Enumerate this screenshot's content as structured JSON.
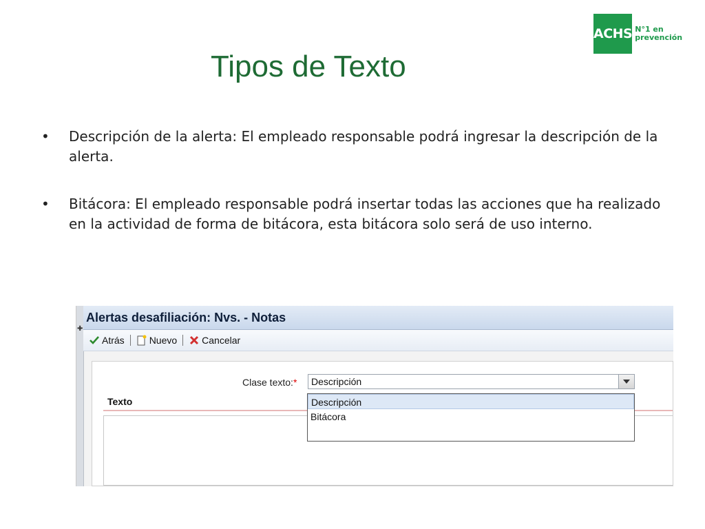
{
  "logo": {
    "mark": "ACHS",
    "tagline_1": "N°1 en",
    "tagline_2": "prevención",
    "color": "#1f9a4c"
  },
  "slide": {
    "title": "Tipos de Texto",
    "bullets": [
      "Descripción de la alerta:  El empleado responsable podrá ingresar la descripción de la alerta.",
      "Bitácora:  El empleado responsable podrá insertar todas las acciones que ha realizado en la actividad de forma de bitácora, esta bitácora solo será de uso interno."
    ]
  },
  "app": {
    "window_title": "Alertas desafiliación: Nvs. - Notas",
    "toolbar": {
      "back_label": "Atrás",
      "new_label": "Nuevo",
      "cancel_label": "Cancelar"
    },
    "form": {
      "clase_label": "Clase texto:",
      "required_mark": "*",
      "clase_value": "Descripción",
      "texto_label": "Texto",
      "options": [
        "Descripción",
        "Bitácora"
      ]
    }
  }
}
